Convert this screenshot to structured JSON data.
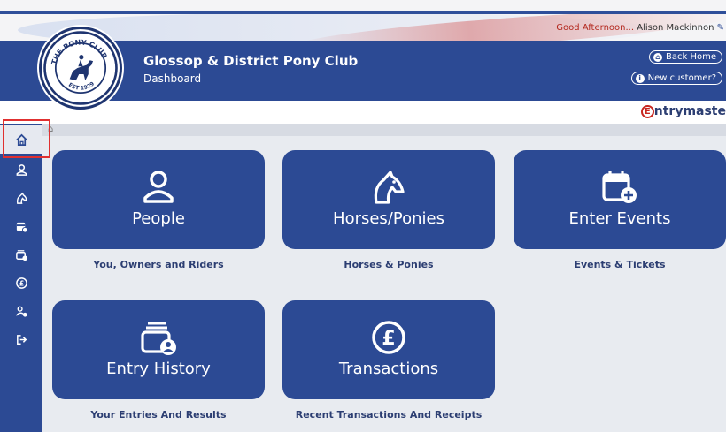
{
  "greeting": {
    "prefix": "Good Afternoon...",
    "user": "Alison Mackinnon"
  },
  "header": {
    "club_name": "Glossop & District Pony Club",
    "subtitle": "Dashboard",
    "back_home": "Back Home",
    "new_customer": "New customer?"
  },
  "brand": {
    "letter": "E",
    "rest": "ntrymaste"
  },
  "logo": {
    "top_text": "THE PONY CLUB",
    "bottom_text": "EST 1929"
  },
  "sidebar": {
    "items": [
      {
        "icon": "home-icon",
        "active": true
      },
      {
        "icon": "person-icon"
      },
      {
        "icon": "horse-icon"
      },
      {
        "icon": "calendar-icon"
      },
      {
        "icon": "entry-history-icon"
      },
      {
        "icon": "pound-icon"
      },
      {
        "icon": "user-settings-icon"
      },
      {
        "icon": "logout-icon"
      }
    ]
  },
  "tiles": [
    {
      "label": "People",
      "caption": "You, Owners and Riders",
      "icon": "person-icon"
    },
    {
      "label": "Horses/Ponies",
      "caption": "Horses & Ponies",
      "icon": "horse-icon"
    },
    {
      "label": "Enter Events",
      "caption": "Events & Tickets",
      "icon": "calendar-plus-icon"
    },
    {
      "label": "Entry History",
      "caption": "Your Entries And Results",
      "icon": "entry-history-icon"
    },
    {
      "label": "Transactions",
      "caption": "Recent Transactions And Receipts",
      "icon": "pound-icon"
    }
  ],
  "colors": {
    "primary": "#2c4a94",
    "accent_red": "#c8261f",
    "background": "#e8ebf0"
  }
}
